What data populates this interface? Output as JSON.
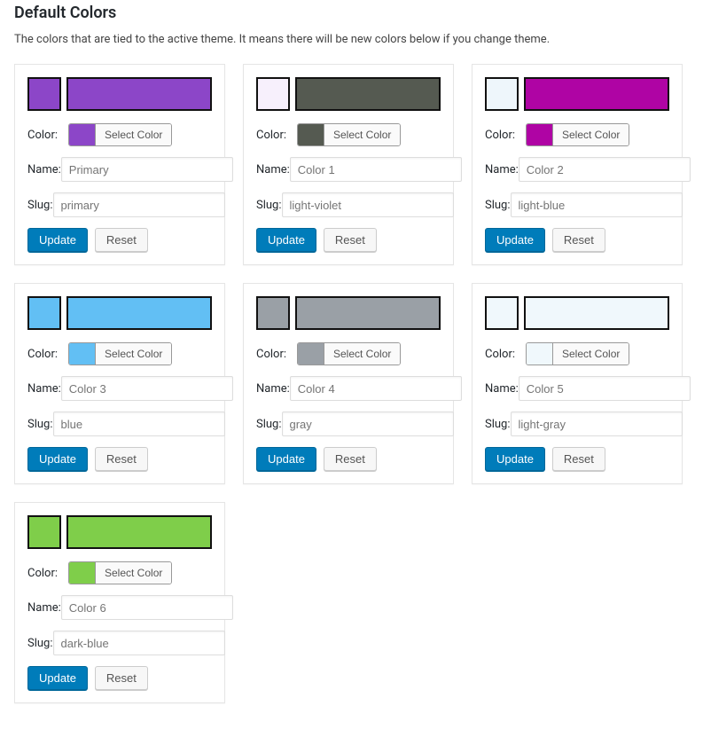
{
  "section": {
    "title": "Default Colors",
    "description": "The colors that are tied to the active theme. It means there will be new colors below if you change theme."
  },
  "labels": {
    "color": "Color:",
    "name": "Name:",
    "slug": "Slug:",
    "select_color": "Select Color",
    "update": "Update",
    "reset": "Reset"
  },
  "colors": [
    {
      "preview_small": "#8c46c8",
      "preview_large": "#8c46c8",
      "picker_swatch": "#8c46c8",
      "name_placeholder": "Primary",
      "slug_placeholder": "primary"
    },
    {
      "preview_small": "#f7f0fc",
      "preview_large": "#555a51",
      "picker_swatch": "#555a51",
      "name_placeholder": "Color 1",
      "slug_placeholder": "light-violet"
    },
    {
      "preview_small": "#eef6fb",
      "preview_large": "#af04a4",
      "picker_swatch": "#af04a4",
      "name_placeholder": "Color 2",
      "slug_placeholder": "light-blue"
    },
    {
      "preview_small": "#62bff4",
      "preview_large": "#62bff4",
      "picker_swatch": "#62bff4",
      "name_placeholder": "Color 3",
      "slug_placeholder": "blue"
    },
    {
      "preview_small": "#9aa0a6",
      "preview_large": "#9aa0a6",
      "picker_swatch": "#9aa0a6",
      "name_placeholder": "Color 4",
      "slug_placeholder": "gray"
    },
    {
      "preview_small": "#f0f8fc",
      "preview_large": "#f0f8fc",
      "picker_swatch": "#f0f8fc",
      "name_placeholder": "Color 5",
      "slug_placeholder": "light-gray"
    },
    {
      "preview_small": "#7fce4a",
      "preview_large": "#7fce4a",
      "picker_swatch": "#7fce4a",
      "name_placeholder": "Color 6",
      "slug_placeholder": "dark-blue"
    }
  ]
}
